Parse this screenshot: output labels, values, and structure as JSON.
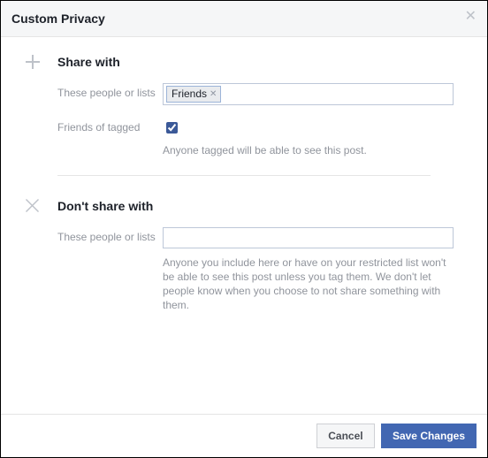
{
  "header": {
    "title": "Custom Privacy"
  },
  "shareWith": {
    "title": "Share with",
    "peopleLabel": "These people or lists",
    "token": "Friends",
    "friendsOfTaggedLabel": "Friends of tagged",
    "friendsOfTaggedChecked": true,
    "helper": "Anyone tagged will be able to see this post."
  },
  "dontShare": {
    "title": "Don't share with",
    "peopleLabel": "These people or lists",
    "helper": "Anyone you include here or have on your restricted list won't be able to see this post unless you tag them. We don't let people know when you choose to not share something with them."
  },
  "footer": {
    "cancel": "Cancel",
    "save": "Save Changes"
  }
}
